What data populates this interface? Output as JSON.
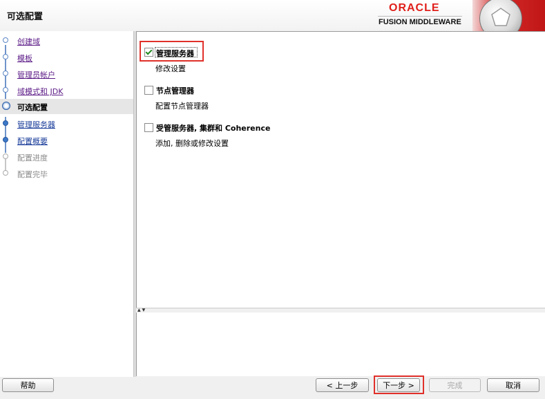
{
  "header": {
    "title": "可选配置",
    "brand": "ORACLE",
    "brand_sub": "FUSION MIDDLEWARE",
    "brand_color": "#e0201b"
  },
  "nav": {
    "items": [
      {
        "label": "创建域",
        "state": "done"
      },
      {
        "label": "模板",
        "state": "done"
      },
      {
        "label": "管理员帐户",
        "state": "done"
      },
      {
        "label": "域模式和 JDK",
        "state": "done"
      },
      {
        "label": "可选配置",
        "state": "current"
      },
      {
        "label": "管理服务器",
        "state": "next"
      },
      {
        "label": "配置概要",
        "state": "next"
      },
      {
        "label": "配置进度",
        "state": "disabled"
      },
      {
        "label": "配置完毕",
        "state": "disabled"
      }
    ]
  },
  "options": [
    {
      "label": "管理服务器",
      "desc": "修改设置",
      "checked": true
    },
    {
      "label": "节点管理器",
      "desc": "配置节点管理器",
      "checked": false
    },
    {
      "label": "受管服务器, 集群和 Coherence",
      "desc": "添加, 删除或修改设置",
      "checked": false
    }
  ],
  "footer": {
    "help": "帮助",
    "back": "< 上一步",
    "next": "下一步 >",
    "finish": "完成",
    "cancel": "取消"
  },
  "splitter_arrows": "▲▼",
  "colors": {
    "highlight": "#e0302a",
    "check": "#1f8a1f",
    "link_visited": "#5b1a86"
  }
}
